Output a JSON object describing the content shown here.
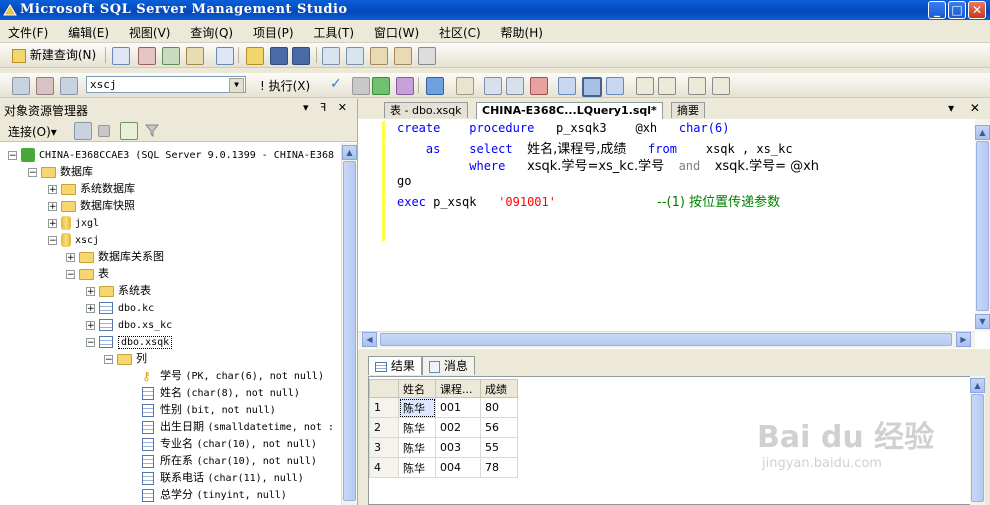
{
  "window": {
    "title": "Microsoft SQL Server Management Studio"
  },
  "menu": [
    "文件(F)",
    "编辑(E)",
    "视图(V)",
    "查询(Q)",
    "项目(P)",
    "工具(T)",
    "窗口(W)",
    "社区(C)",
    "帮助(H)"
  ],
  "toolbar": {
    "new_query": "新建查询(N)",
    "database": "xscj",
    "execute": "! 执行(X)"
  },
  "explorer": {
    "title": "对象资源管理器",
    "pane_controls": "▾ ꟻ ✕",
    "connect": "连接(O)▾",
    "tree": {
      "server": "CHINA-E368CCAE3 (SQL Server 9.0.1399 - CHINA-E368",
      "databases": "数据库",
      "system_dbs": "系统数据库",
      "snapshots": "数据库快照",
      "db_jxgl": "jxgl",
      "db_xscj": "xscj",
      "diagrams": "数据库关系图",
      "tables": "表",
      "system_tables": "系统表",
      "table_kc": "dbo.kc",
      "table_xs_kc": "dbo.xs_kc",
      "table_xsqk": "dbo.xsqk",
      "columns_folder": "列",
      "columns": [
        {
          "name": "学号",
          "type": "(PK, char(6), not null)"
        },
        {
          "name": "姓名",
          "type": "(char(8), not null)"
        },
        {
          "name": "性别",
          "type": "(bit, not null)"
        },
        {
          "name": "出生日期",
          "type": "(smalldatetime, not :"
        },
        {
          "name": "专业名",
          "type": "(char(10), not null)"
        },
        {
          "name": "所在系",
          "type": "(char(10), not null)"
        },
        {
          "name": "联系电话",
          "type": "(char(11), null)"
        },
        {
          "name": "总学分",
          "type": "(tinyint, null)"
        }
      ]
    }
  },
  "editor": {
    "tabs": [
      "表 - dbo.xsqk",
      "CHINA-E368C...LQuery1.sql*",
      "摘要"
    ],
    "close_controls": "▾ ✕",
    "code": {
      "l1_kw1": "create",
      "l1_kw2": "procedure",
      "l1_name": "p_xsqk3",
      "l1_param": "@xh",
      "l1_type": "char(6)",
      "l2_as": "as",
      "l2_select": "select",
      "l2_cols": "姓名,课程号,成绩",
      "l2_from": "from",
      "l2_tables": "xsqk , xs_kc",
      "l3_where": "where",
      "l3_cond1": "xsqk.学号=xs_kc.学号",
      "l3_and": "and",
      "l3_cond2": "xsqk.学号= @xh",
      "l4_go": "go",
      "l5_exec": "exec",
      "l5_proc": "p_xsqk",
      "l5_arg": "'091001'",
      "l5_comment": "--(1) 按位置传递参数"
    }
  },
  "results": {
    "tabs": [
      "结果",
      "消息"
    ],
    "columns": [
      "姓名",
      "课程...",
      "成绩"
    ],
    "rows": [
      {
        "n": "1",
        "name": "陈华",
        "course": "001",
        "score": "80"
      },
      {
        "n": "2",
        "name": "陈华",
        "course": "002",
        "score": "56"
      },
      {
        "n": "3",
        "name": "陈华",
        "course": "003",
        "score": "55"
      },
      {
        "n": "4",
        "name": "陈华",
        "course": "004",
        "score": "78"
      }
    ]
  },
  "watermark": {
    "brand": "Bai du 经验",
    "url": "jingyan.baidu.com"
  },
  "colors": {
    "titlebar": "#0a5fd8",
    "keyword": "#0000ff",
    "string": "#ff0000",
    "comment": "#008000",
    "gutter": "#ffff40"
  }
}
